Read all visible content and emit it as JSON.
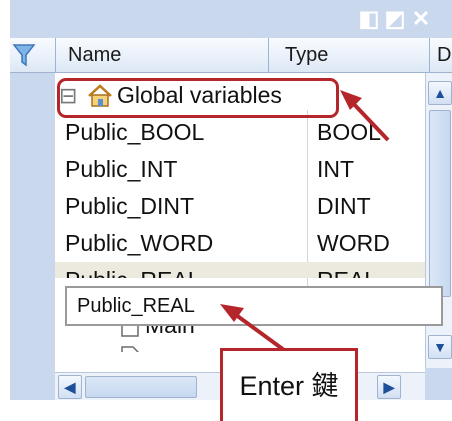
{
  "window": {
    "title_buttons": [
      "split-view",
      "edit",
      "close"
    ]
  },
  "columns": [
    {
      "label": "Name"
    },
    {
      "label": "Type"
    },
    {
      "label": "D"
    }
  ],
  "tree": {
    "expander": "⊟",
    "group_icon": "house-icon",
    "group_label": "Global variables"
  },
  "rows": [
    {
      "name": "Public_BOOL",
      "type": "BOOL"
    },
    {
      "name": "Public_INT",
      "type": "INT"
    },
    {
      "name": "Public_DINT",
      "type": "DINT"
    },
    {
      "name": "Public_WORD",
      "type": "WORD"
    },
    {
      "name": "Public_REAL",
      "type": "REAL"
    }
  ],
  "edit_box": {
    "value": "Public_REAL"
  },
  "program": {
    "icon": "document-icon",
    "label": "Main"
  },
  "callout": {
    "text": "Enter 鍵"
  },
  "colors": {
    "highlight": "#b5262b",
    "panel": "#c9d8ec"
  }
}
